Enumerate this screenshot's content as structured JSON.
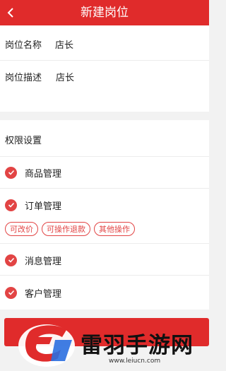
{
  "header": {
    "title": "新建岗位",
    "back_icon": "chevron-left-icon"
  },
  "form": {
    "name_label": "岗位名称",
    "name_value": "店长",
    "desc_label": "岗位描述",
    "desc_value": "店长"
  },
  "permissions": {
    "title": "权限设置",
    "items": [
      {
        "label": "商品管理",
        "checked": true
      },
      {
        "label": "订单管理",
        "checked": true
      },
      {
        "label": "消息管理",
        "checked": true
      },
      {
        "label": "客户管理",
        "checked": true
      }
    ],
    "order_tags": [
      "可改价",
      "可操作退款",
      "其他操作"
    ]
  },
  "watermark": {
    "title": "雷羽手游网",
    "url": "www.leiucn.com"
  },
  "colors": {
    "accent": "#e02b2b",
    "check": "#e24444"
  }
}
